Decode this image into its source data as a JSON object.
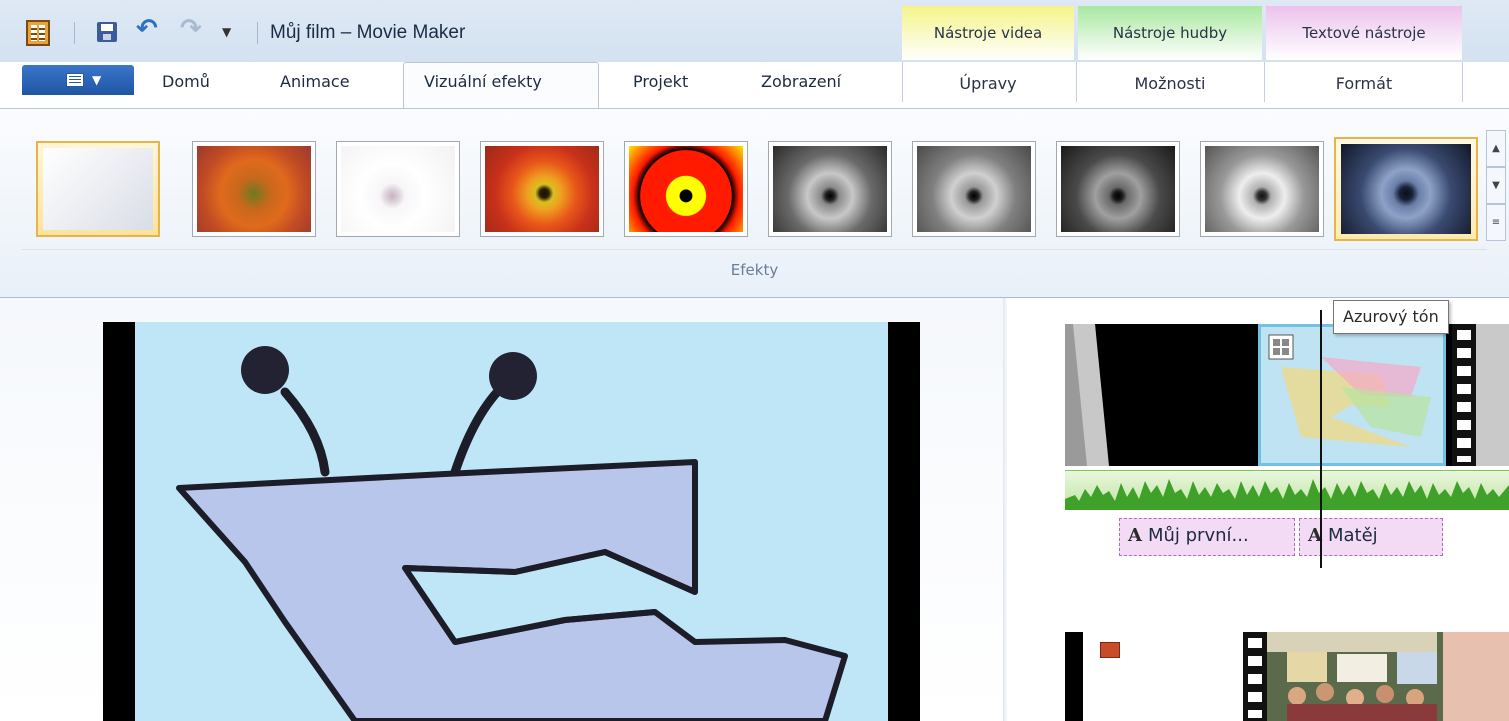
{
  "window": {
    "title": "Můj film – Movie Maker"
  },
  "quick_access": {
    "icons": [
      "app-icon",
      "save-icon",
      "undo-icon",
      "redo-icon",
      "qa-dropdown-icon"
    ]
  },
  "tabs": [
    {
      "label": "Domů",
      "active": false
    },
    {
      "label": "Animace",
      "active": false
    },
    {
      "label": "Vizuální efekty",
      "active": true
    },
    {
      "label": "Projekt",
      "active": false
    },
    {
      "label": "Zobrazení",
      "active": false
    }
  ],
  "contextual_groups": [
    {
      "header": "Nástroje videa",
      "tab": "Úpravy",
      "color": "#f4f48a"
    },
    {
      "header": "Nástroje hudby",
      "tab": "Možnosti",
      "color": "#a8e8a0"
    },
    {
      "header": "Textové nástroje",
      "tab": "Formát",
      "color": "#ecc2ee"
    }
  ],
  "ribbon": {
    "group_label": "Efekty",
    "effects": [
      {
        "icon": "no-effect",
        "state": "selected"
      },
      {
        "icon": "blur-effect"
      },
      {
        "icon": "edge-detect-effect"
      },
      {
        "icon": "warm-effect"
      },
      {
        "icon": "posterize-effect"
      },
      {
        "icon": "bw-effect"
      },
      {
        "icon": "bw-contrast-effect"
      },
      {
        "icon": "bw-dark-effect"
      },
      {
        "icon": "bw-light-effect"
      },
      {
        "icon": "cyan-tone-effect",
        "state": "hover"
      }
    ]
  },
  "tooltip": {
    "text": "Azurový tón"
  },
  "storyboard": {
    "captions": [
      {
        "text": "Můj první..."
      },
      {
        "text": "Matěj"
      }
    ]
  }
}
